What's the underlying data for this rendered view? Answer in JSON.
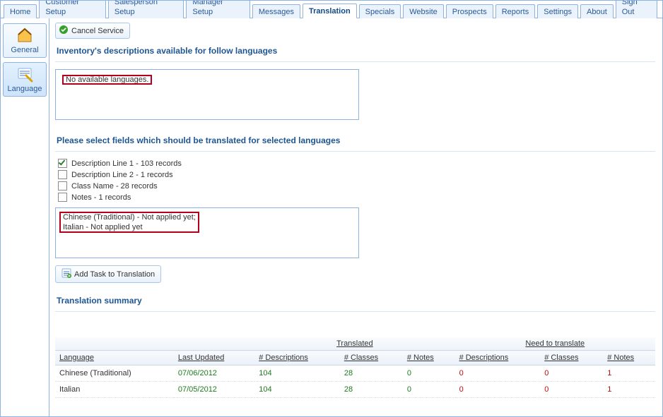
{
  "tabs": [
    "Home",
    "Customer Setup",
    "Salesperson Setup",
    "Manager Setup",
    "Messages",
    "Translation",
    "Specials",
    "Website",
    "Prospects",
    "Reports",
    "Settings",
    "About",
    "Sign Out"
  ],
  "tabs_active_index": 5,
  "sidebar": {
    "general_label": "General",
    "language_label": "Language"
  },
  "toolbar": {
    "cancel_label": "Cancel Service"
  },
  "sections": {
    "available_title": "Inventory's descriptions available for follow languages",
    "no_languages": "No available languages.",
    "fields_title": "Please select fields which should be translated for selected languages",
    "summary_title": "Translation summary"
  },
  "fields": [
    {
      "checked": true,
      "label": "Description Line 1 - 103 records"
    },
    {
      "checked": false,
      "label": "Description Line 2 - 1 records"
    },
    {
      "checked": false,
      "label": "Class Name - 28 records"
    },
    {
      "checked": false,
      "label": "Notes - 1 records"
    }
  ],
  "lang_selection": {
    "line1": "Chinese (Traditional) - Not applied yet;",
    "line2": "Italian - Not applied yet"
  },
  "add_task_label": "Add Task to Translation",
  "summary_groups": {
    "translated": "Translated",
    "need": "Need to translate"
  },
  "summary_headers": {
    "language": "Language",
    "last_updated": "Last Updated",
    "descriptions": "# Descriptions",
    "classes": "# Classes",
    "notes": "# Notes"
  },
  "summary_rows": [
    {
      "language": "Chinese (Traditional)",
      "last_updated": "07/06/2012",
      "t_desc": "104",
      "t_class": "28",
      "t_notes": "0",
      "n_desc": "0",
      "n_class": "0",
      "n_notes": "1"
    },
    {
      "language": "Italian",
      "last_updated": "07/05/2012",
      "t_desc": "104",
      "t_class": "28",
      "t_notes": "0",
      "n_desc": "0",
      "n_class": "0",
      "n_notes": "1"
    }
  ]
}
